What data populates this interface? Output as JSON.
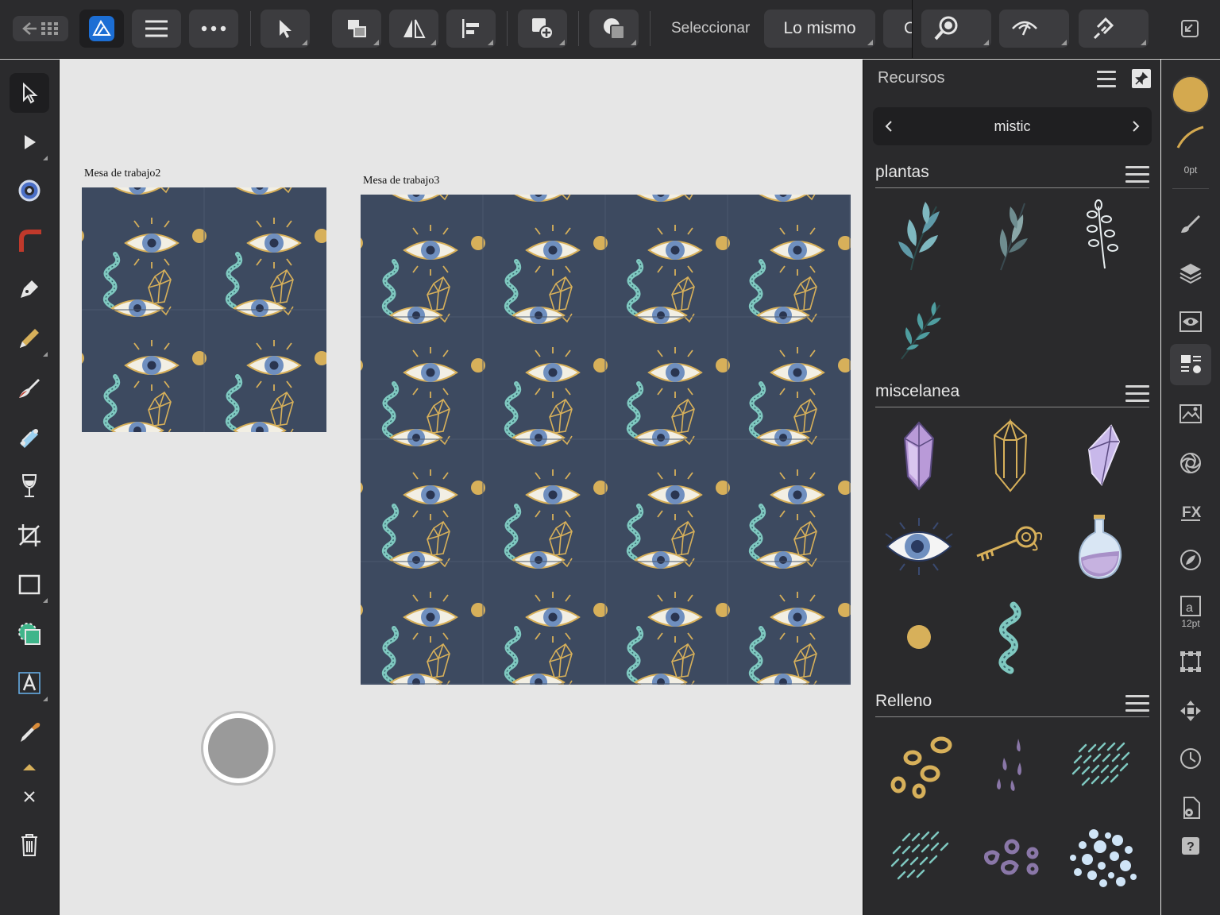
{
  "toolbar": {
    "select_label": "Seleccionar",
    "same_label": "Lo mismo",
    "clipped_label": "C"
  },
  "canvas": {
    "artboard1_label": "Mesa de trabajo2",
    "artboard2_label": "Mesa de trabajo3",
    "pattern_colors": {
      "background": "#3d4a60",
      "gold": "#d7b05a",
      "eye_iris": "#6f8fbf",
      "snake": "#7fc8c0"
    }
  },
  "panel": {
    "title": "Recursos",
    "collection_name": "mistic",
    "categories": [
      {
        "name": "plantas",
        "items": [
          "leaf-sprig-1",
          "leaf-sprig-2",
          "leaf-sprig-3",
          "leaf-sprig-4"
        ]
      },
      {
        "name": "miscelanea",
        "items": [
          "purple-crystal",
          "gold-crystal",
          "lilac-crystal",
          "evil-eye",
          "gold-key",
          "potion-bottle",
          "moon-phases",
          "snake"
        ]
      },
      {
        "name": "Relleno",
        "items": [
          "gold-rings",
          "purple-drops",
          "teal-dashes",
          "teal-dashes-2",
          "purple-rings",
          "blue-dots"
        ]
      }
    ]
  },
  "rightbar": {
    "stroke_width_label": "0pt",
    "text_size_label": "12pt",
    "color_swatch": "#d4a94f"
  }
}
